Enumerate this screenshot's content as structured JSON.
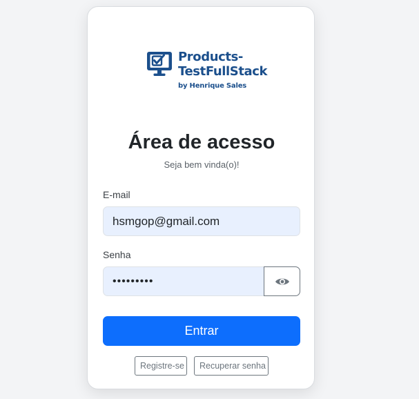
{
  "brand": {
    "name_line1": "Products-",
    "name_line2": "TestFullStack",
    "byline": "by Henrique Sales",
    "logo_icon": "monitor-check-icon",
    "color": "#1b4f8c"
  },
  "login": {
    "title": "Área de acesso",
    "subtitle": "Seja bem vinda(o)!",
    "email_label": "E-mail",
    "email_value": "hsmgop@gmail.com",
    "password_label": "Senha",
    "password_value": "•••••••••",
    "password_toggle_icon": "eye-icon",
    "submit_label": "Entrar",
    "register_label": "Registre-se",
    "recover_label": "Recuperar senha"
  },
  "colors": {
    "primary": "#0d6efd",
    "input_background": "#e8f0fe",
    "secondary": "#6c757d",
    "page_background": "#f3f4f6"
  }
}
